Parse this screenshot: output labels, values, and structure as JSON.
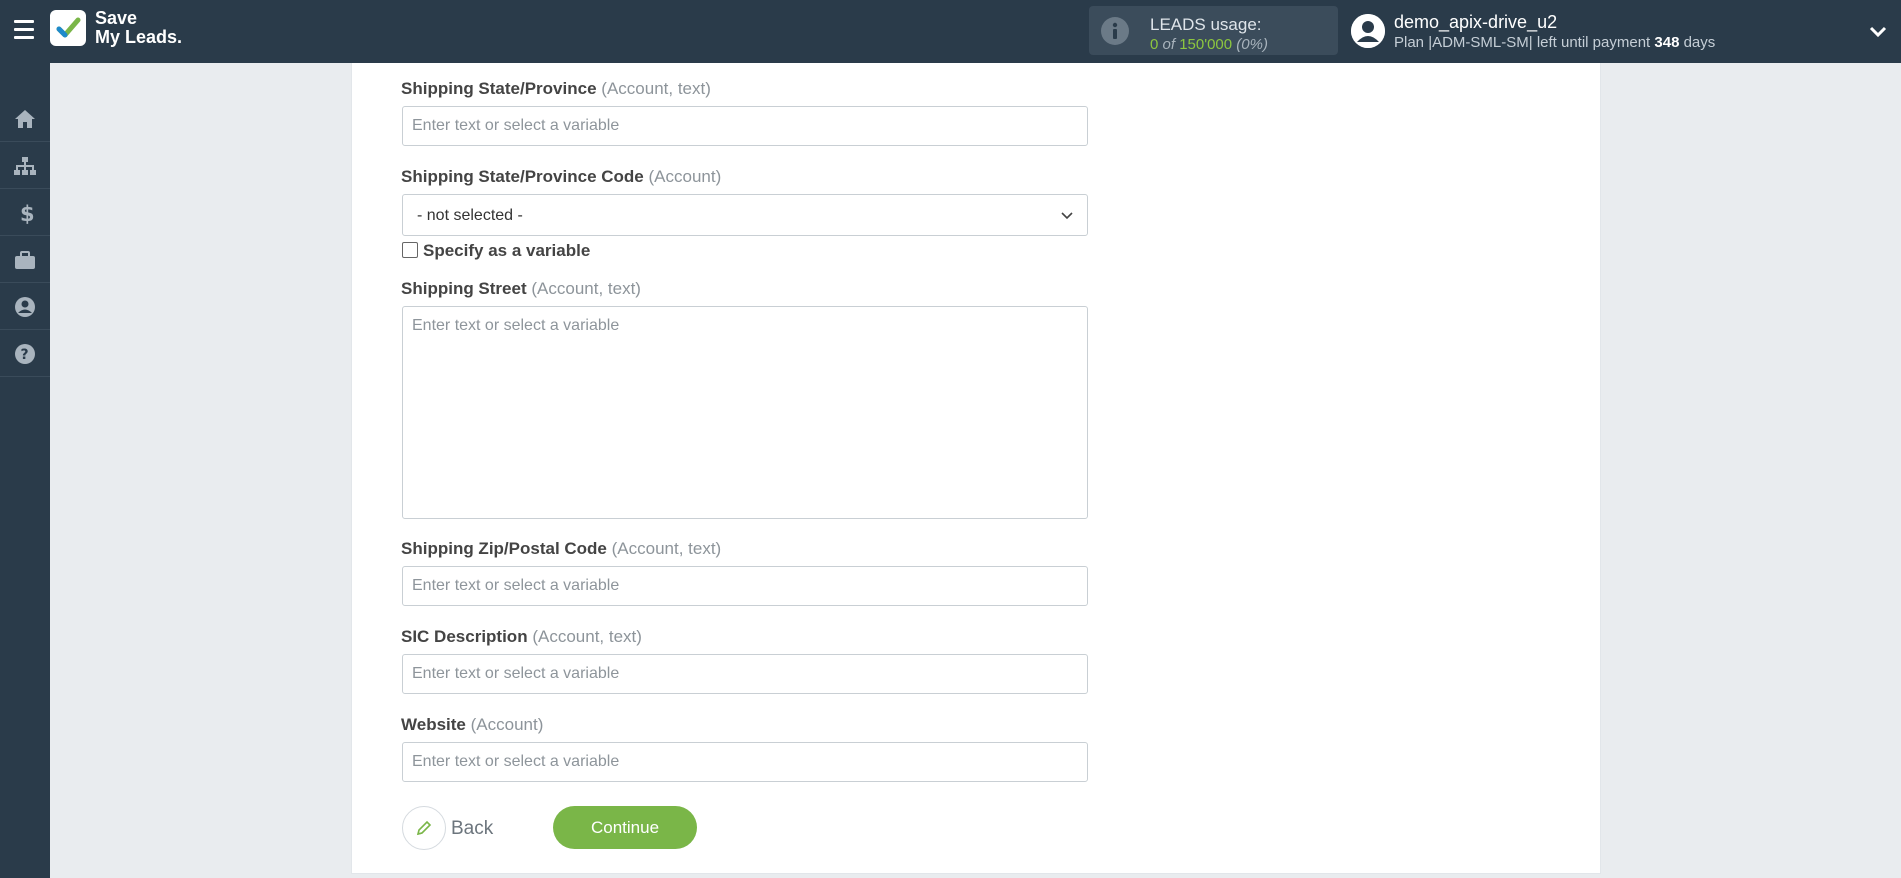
{
  "header": {
    "logo_line1": "Save",
    "logo_line2": "My Leads.",
    "leads_title": "LEADS usage:",
    "leads_used": "0",
    "leads_of": "of",
    "leads_total": "150'000",
    "leads_percent": "(0%)",
    "user_name": "demo_apix-drive_u2",
    "plan_text": "Plan |ADM-SML-SM| left until payment",
    "days_left": "348",
    "days_label": "days"
  },
  "sidebar": {
    "items": [
      "home-icon",
      "sitemap-icon",
      "dollar-icon",
      "briefcase-icon",
      "user-icon",
      "help-icon"
    ]
  },
  "form": {
    "fields": [
      {
        "label": "Shipping State/Province",
        "hint": "(Account, text)",
        "placeholder": "Enter text or select a variable"
      },
      {
        "label": "Shipping State/Province Code",
        "hint": "(Account)",
        "selected": "- not selected -",
        "checkbox_label": "Specify as a variable"
      },
      {
        "label": "Shipping Street",
        "hint": "(Account, text)",
        "placeholder": "Enter text or select a variable"
      },
      {
        "label": "Shipping Zip/Postal Code",
        "hint": "(Account, text)",
        "placeholder": "Enter text or select a variable"
      },
      {
        "label": "SIC Description",
        "hint": "(Account, text)",
        "placeholder": "Enter text or select a variable"
      },
      {
        "label": "Website",
        "hint": "(Account)",
        "placeholder": "Enter text or select a variable"
      }
    ]
  },
  "actions": {
    "back_label": "Back",
    "continue_label": "Continue"
  },
  "colors": {
    "topbar": "#2a3b4a",
    "accent": "#7ab648",
    "usage_green": "#8dc63f"
  }
}
